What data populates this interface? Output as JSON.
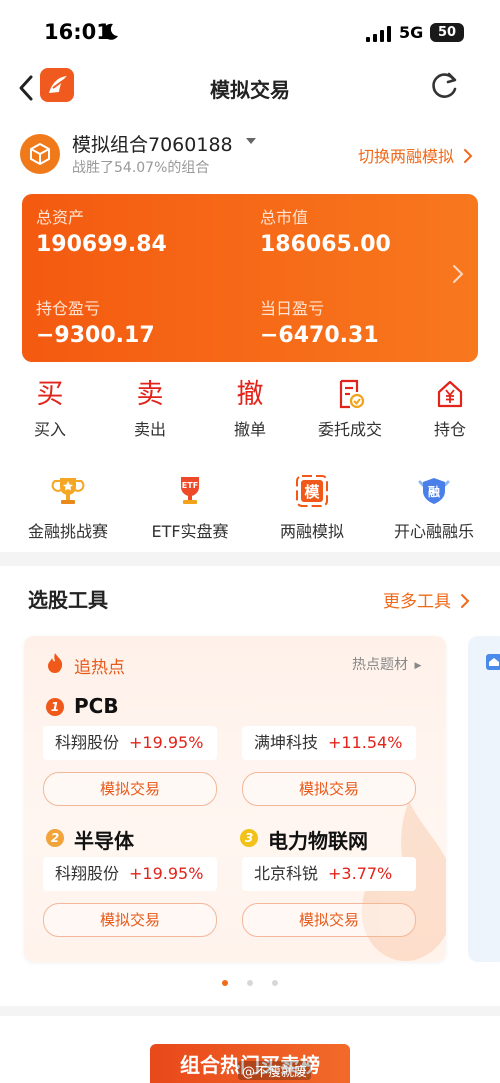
{
  "status": {
    "time": "16:01",
    "network": "5G",
    "battery": "50"
  },
  "nav": {
    "title": "模拟交易"
  },
  "portfolio": {
    "name": "模拟组合7060188",
    "subtitle": "战胜了54.07%的组合",
    "switch_label": "切换两融模拟"
  },
  "assets": {
    "total_label": "总资产",
    "total_value": "190699.84",
    "market_label": "总市值",
    "market_value": "186065.00",
    "holding_pl_label": "持仓盈亏",
    "holding_pl_value": "−9300.17",
    "daily_pl_label": "当日盈亏",
    "daily_pl_value": "−6470.31"
  },
  "actions": [
    {
      "icon_char": "买",
      "label": "买入"
    },
    {
      "icon_char": "卖",
      "label": "卖出"
    },
    {
      "icon_char": "撤",
      "label": "撤单"
    },
    {
      "icon": "order-doc-icon",
      "label": "委托成交"
    },
    {
      "icon": "house-yen-icon",
      "label": "持仓"
    }
  ],
  "modes": [
    {
      "icon": "trophy-icon",
      "label": "金融挑战赛"
    },
    {
      "icon": "etf-trophy-icon",
      "label": "ETF实盘赛",
      "badge": "ETF"
    },
    {
      "icon": "margin-sim-icon",
      "label": "两融模拟",
      "badge": "模"
    },
    {
      "icon": "shield-badge-icon",
      "label": "开心融融乐",
      "badge": "融"
    }
  ],
  "tools": {
    "title": "选股工具",
    "more_label": "更多工具",
    "hot": {
      "title": "追热点",
      "more_label": "热点题材",
      "sectors": [
        {
          "rank": "1",
          "name": "PCB",
          "stocks": [
            {
              "name": "科翔股份",
              "change": "+19.95%"
            },
            {
              "name": "满坤科技",
              "change": "+11.54%"
            }
          ],
          "buttons": [
            "模拟交易",
            "模拟交易"
          ]
        },
        {
          "rank": "2",
          "name": "半导体",
          "stock": {
            "name": "科翔股份",
            "change": "+19.95%"
          },
          "button": "模拟交易"
        },
        {
          "rank": "3",
          "name": "电力物联网",
          "stock": {
            "name": "北京科锐",
            "change": "+3.77%"
          },
          "button": "模拟交易"
        }
      ]
    }
  },
  "banner": {
    "title": "组合热门买卖榜"
  },
  "watermark": "@不瘦就废",
  "colors": {
    "accent": "#f06a1a",
    "red": "#e2231a",
    "card_start": "#f45a10",
    "card_end": "#f8781e"
  }
}
